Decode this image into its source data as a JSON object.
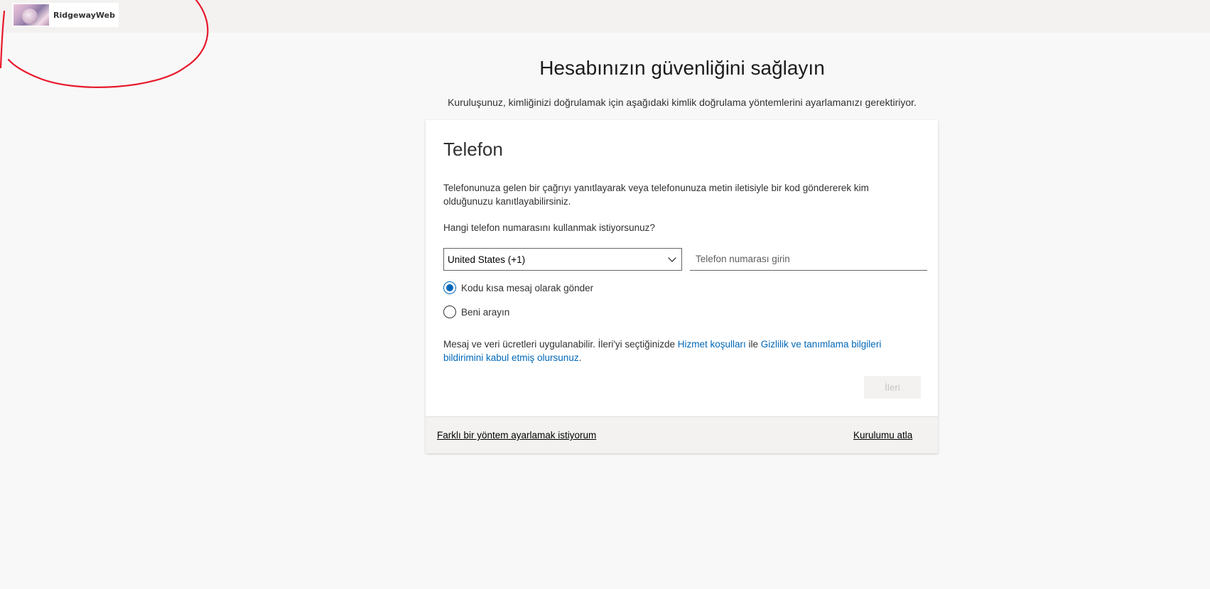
{
  "header": {
    "logo_text": "RidgewayWeb"
  },
  "annotation": {
    "color": "#e8192c"
  },
  "page": {
    "title": "Hesabınızın güvenliğini sağlayın",
    "subtitle": "Kuruluşunuz, kimliğinizi doğrulamak için aşağıdaki kimlik doğrulama yöntemlerini ayarlamanızı gerektiriyor."
  },
  "card": {
    "title": "Telefon",
    "description": "Telefonunuza gelen bir çağrıyı yanıtlayarak veya telefonunuza metin iletisiyle bir kod göndererek kim olduğunuzu kanıtlayabilirsiniz.",
    "question": "Hangi telefon numarasını kullanmak istiyorsunuz?",
    "country_select": {
      "selected": "United States (+1)"
    },
    "phone_input": {
      "value": "",
      "placeholder": "Telefon numarası girin"
    },
    "options": [
      {
        "label": "Kodu kısa mesaj olarak gönder",
        "checked": true
      },
      {
        "label": "Beni arayın",
        "checked": false
      }
    ],
    "terms": {
      "prefix": "Mesaj ve veri ücretleri uygulanabilir. İleri'yi seçtiğinizde ",
      "link1": "Hizmet koşulları",
      "middle": " ile ",
      "link2": "Gizlilik ve tanımlama bilgileri bildirimini kabul etmiş olursunuz",
      "suffix": "."
    },
    "next_label": "İleri"
  },
  "footer": {
    "other_method": "Farklı bir yöntem ayarlamak istiyorum",
    "skip_setup": "Kurulumu atla"
  },
  "colors": {
    "accent": "#0067b8",
    "background": "#f8f8f8"
  }
}
